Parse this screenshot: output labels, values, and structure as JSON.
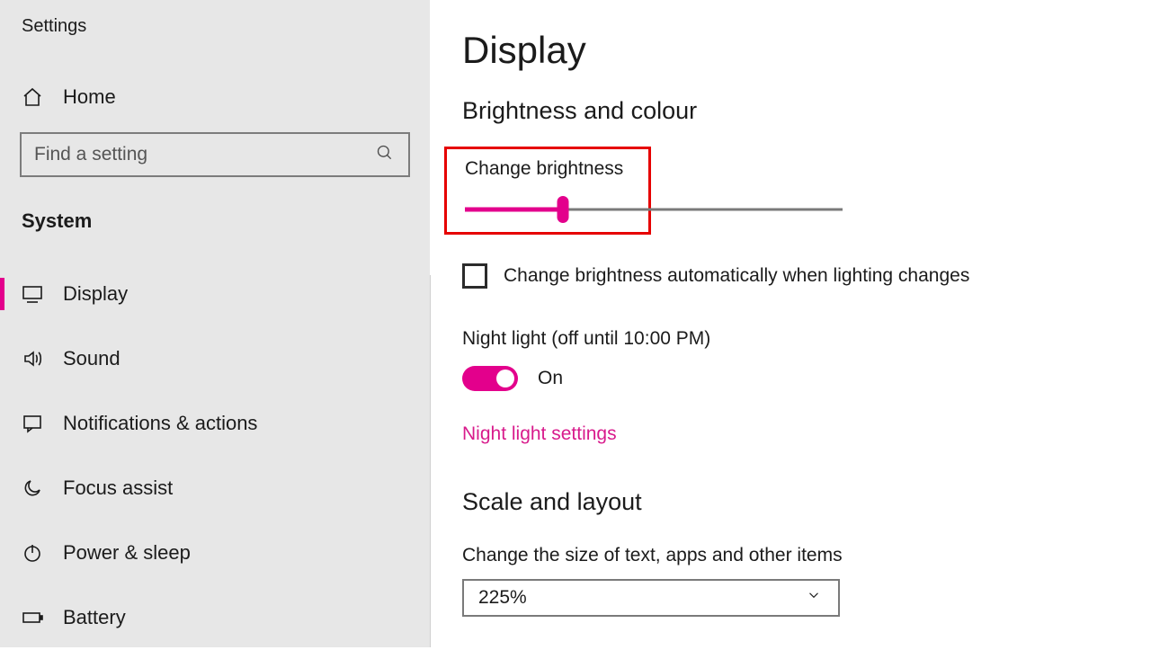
{
  "app_title": "Settings",
  "accent": "#e3008c",
  "sidebar": {
    "home_label": "Home",
    "search_placeholder": "Find a setting",
    "section_label": "System",
    "items": [
      {
        "label": "Display",
        "icon": "monitor",
        "active": true
      },
      {
        "label": "Sound",
        "icon": "speaker",
        "active": false
      },
      {
        "label": "Notifications & actions",
        "icon": "message",
        "active": false
      },
      {
        "label": "Focus assist",
        "icon": "moon",
        "active": false
      },
      {
        "label": "Power & sleep",
        "icon": "power",
        "active": false
      },
      {
        "label": "Battery",
        "icon": "battery",
        "active": false
      }
    ]
  },
  "main": {
    "title": "Display",
    "brightness_heading": "Brightness and colour",
    "brightness_label": "Change brightness",
    "brightness_value_percent": 26,
    "auto_brightness_label": "Change brightness automatically when lighting changes",
    "auto_brightness_checked": false,
    "night_light_title": "Night light (off until 10:00 PM)",
    "night_light_state_label": "On",
    "night_light_on": true,
    "night_light_link": "Night light settings",
    "scale_heading": "Scale and layout",
    "scale_caption": "Change the size of text, apps and other items",
    "scale_selected": "225%"
  }
}
